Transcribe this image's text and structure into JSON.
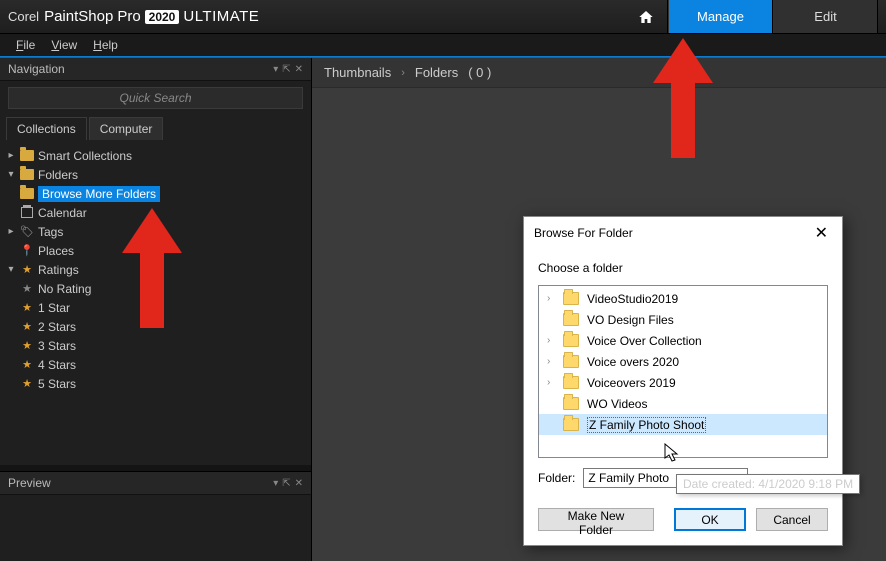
{
  "app": {
    "brand_corel": "Corel",
    "brand_name": "PaintShop",
    "brand_pro": "Pro",
    "brand_year": "2020",
    "brand_edition": "ULTIMATE"
  },
  "top_tabs": {
    "manage": "Manage",
    "edit": "Edit"
  },
  "menu": {
    "file": "File",
    "view": "View",
    "help": "Help"
  },
  "nav": {
    "title": "Navigation",
    "quick_search": "Quick Search",
    "tab_collections": "Collections",
    "tab_computer": "Computer",
    "smart_collections": "Smart Collections",
    "folders": "Folders",
    "browse_more": "Browse More Folders",
    "calendar": "Calendar",
    "tags": "Tags",
    "places": "Places",
    "ratings": "Ratings",
    "no_rating": "No Rating",
    "star1": "1 Star",
    "star2": "2 Stars",
    "star3": "3 Stars",
    "star4": "4 Stars",
    "star5": "5 Stars"
  },
  "preview": {
    "title": "Preview"
  },
  "breadcrumb": {
    "thumbnails": "Thumbnails",
    "folders": "Folders",
    "count": "( 0 )"
  },
  "dialog": {
    "title": "Browse For Folder",
    "instruction": "Choose a folder",
    "folders": {
      "f0": "VideoStudio2019",
      "f1": "VO Design Files",
      "f2": "Voice Over Collection",
      "f3": "Voice overs 2020",
      "f4": "Voiceovers 2019",
      "f5": "WO Videos",
      "f6": "Z Family Photo Shoot"
    },
    "folder_label": "Folder:",
    "folder_value": "Z Family Photo",
    "tooltip": "Date created: 4/1/2020 9:18 PM",
    "make_new": "Make New Folder",
    "ok": "OK",
    "cancel": "Cancel"
  }
}
